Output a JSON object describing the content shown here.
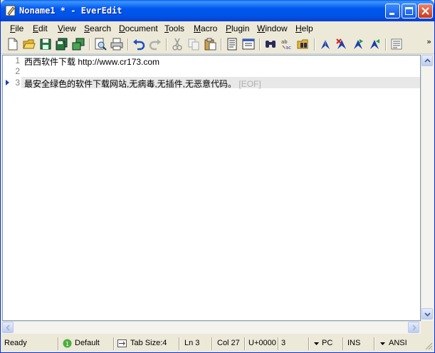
{
  "window": {
    "title": "Noname1 * - EverEdit"
  },
  "menu": [
    {
      "label": "File",
      "u": "F",
      "rest": "ile"
    },
    {
      "label": "Edit",
      "u": "E",
      "rest": "dit"
    },
    {
      "label": "View",
      "u": "V",
      "rest": "iew"
    },
    {
      "label": "Search",
      "u": "S",
      "rest": "earch"
    },
    {
      "label": "Document",
      "u": "D",
      "rest": "ocument"
    },
    {
      "label": "Tools",
      "u": "T",
      "rest": "ools"
    },
    {
      "label": "Macro",
      "u": "M",
      "rest": "acro"
    },
    {
      "label": "Plugin",
      "u": "P",
      "rest": "lugin"
    },
    {
      "label": "Window",
      "u": "W",
      "rest": "indow"
    },
    {
      "label": "Help",
      "u": "H",
      "rest": "elp"
    }
  ],
  "toolbar": {
    "more": "»",
    "icons": [
      "new-file-icon",
      "open-folder-icon",
      "save-icon",
      "save-all-icon",
      "copy-window-icon",
      "print-preview-icon",
      "print-icon",
      "undo-icon",
      "redo-icon",
      "cut-icon",
      "copy-icon",
      "paste-icon",
      "document-icon",
      "properties-icon",
      "find-icon",
      "replace-icon",
      "find-in-files-icon",
      "bookmark-toggle-icon",
      "bookmark-clear-icon",
      "bookmark-next-icon",
      "bookmark-prev-icon",
      "word-wrap-icon"
    ]
  },
  "editor": {
    "lines": [
      {
        "no": "1",
        "text": "西西软件下载 http://www.cr173.com"
      },
      {
        "no": "2",
        "text": ""
      },
      {
        "no": "3",
        "text": "最安全绿色的软件下载网站,无病毒,无插件,无恶意代码。"
      }
    ],
    "eof_marker": "[EOF]"
  },
  "status": {
    "ready": "Ready",
    "syntax": "Default",
    "tab_size": "Tab Size:4",
    "line": "Ln 3",
    "col": "Col 27",
    "unicode": "U+0000",
    "sel": "3",
    "line_ending": "PC",
    "mode": "INS",
    "encoding": "ANSI"
  }
}
